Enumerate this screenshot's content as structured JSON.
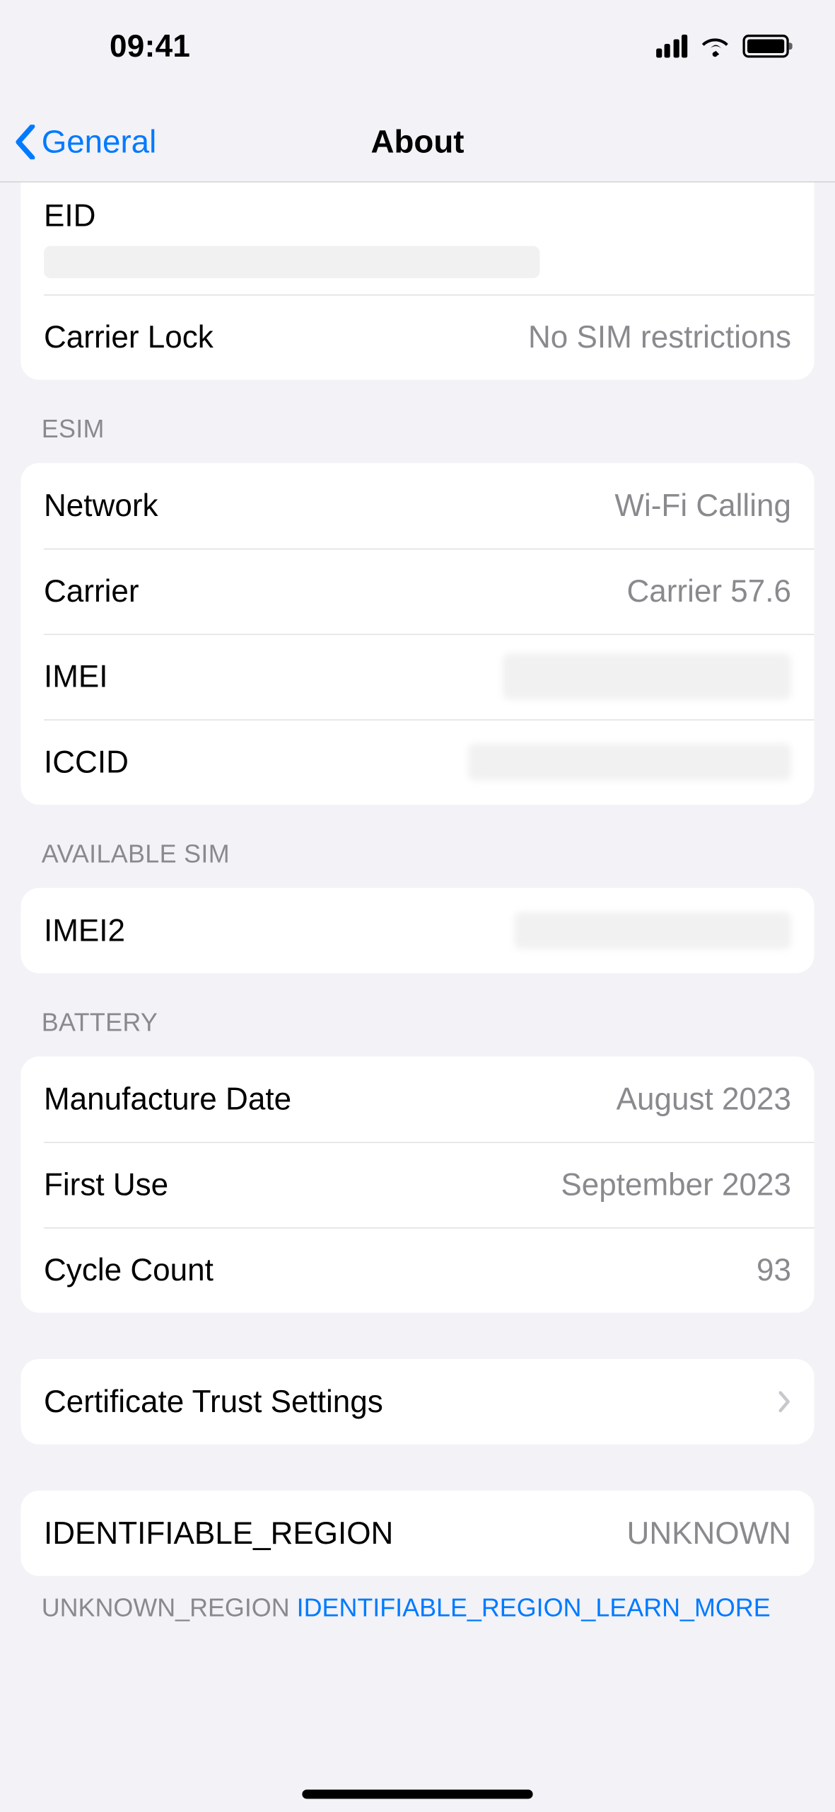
{
  "status": {
    "time": "09:41"
  },
  "nav": {
    "back_label": "General",
    "title": "About"
  },
  "top_group": {
    "eid_label": "EID",
    "carrier_lock_label": "Carrier Lock",
    "carrier_lock_value": "No SIM restrictions"
  },
  "esim": {
    "header": "ESIM",
    "network_label": "Network",
    "network_value": "Wi-Fi Calling",
    "carrier_label": "Carrier",
    "carrier_value": "Carrier 57.6",
    "imei_label": "IMEI",
    "iccid_label": "ICCID"
  },
  "available_sim": {
    "header": "AVAILABLE SIM",
    "imei2_label": "IMEI2"
  },
  "battery": {
    "header": "BATTERY",
    "manufacture_label": "Manufacture Date",
    "manufacture_value": "August 2023",
    "first_use_label": "First Use",
    "first_use_value": "September 2023",
    "cycle_count_label": "Cycle Count",
    "cycle_count_value": "93"
  },
  "cert": {
    "label": "Certificate Trust Settings"
  },
  "region": {
    "label": "IDENTIFIABLE_REGION",
    "value": "UNKNOWN",
    "footer_prefix": "UNKNOWN_REGION ",
    "footer_link": "IDENTIFIABLE_REGION_LEARN_MORE"
  }
}
